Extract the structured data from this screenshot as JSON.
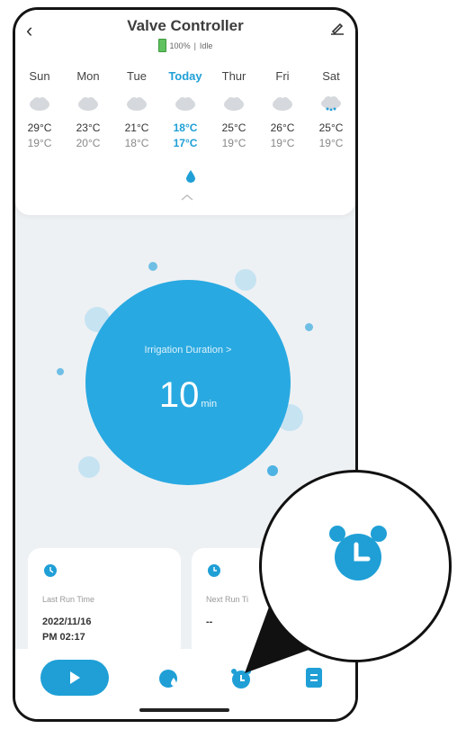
{
  "header": {
    "title": "Valve Controller",
    "battery": "100%",
    "state": "Idle"
  },
  "forecast": [
    {
      "day": "Sun",
      "high": "29°C",
      "low": "19°C",
      "icon": "cloud-icon"
    },
    {
      "day": "Mon",
      "high": "23°C",
      "low": "20°C",
      "icon": "cloud-icon"
    },
    {
      "day": "Tue",
      "high": "21°C",
      "low": "18°C",
      "icon": "cloud-icon"
    },
    {
      "day": "Today",
      "high": "18°C",
      "low": "17°C",
      "icon": "cloud-icon"
    },
    {
      "day": "Thur",
      "high": "25°C",
      "low": "19°C",
      "icon": "cloud-icon"
    },
    {
      "day": "Fri",
      "high": "26°C",
      "low": "19°C",
      "icon": "cloud-icon"
    },
    {
      "day": "Sat",
      "high": "25°C",
      "low": "19°C",
      "icon": "rain-cloud-icon"
    }
  ],
  "irrigation": {
    "label": "Irrigation Duration >",
    "value": "10",
    "unit": "min"
  },
  "last_run": {
    "label": "Last Run Time",
    "date": "2022/11/16",
    "time": "PM 02:17"
  },
  "next_run": {
    "label": "Next Run Ti",
    "value": "--"
  },
  "colors": {
    "accent": "#1f9fd6",
    "circle": "#29a9e1"
  },
  "nav": [
    "play-icon",
    "drop-icon",
    "alarm-clock-icon",
    "log-icon"
  ]
}
